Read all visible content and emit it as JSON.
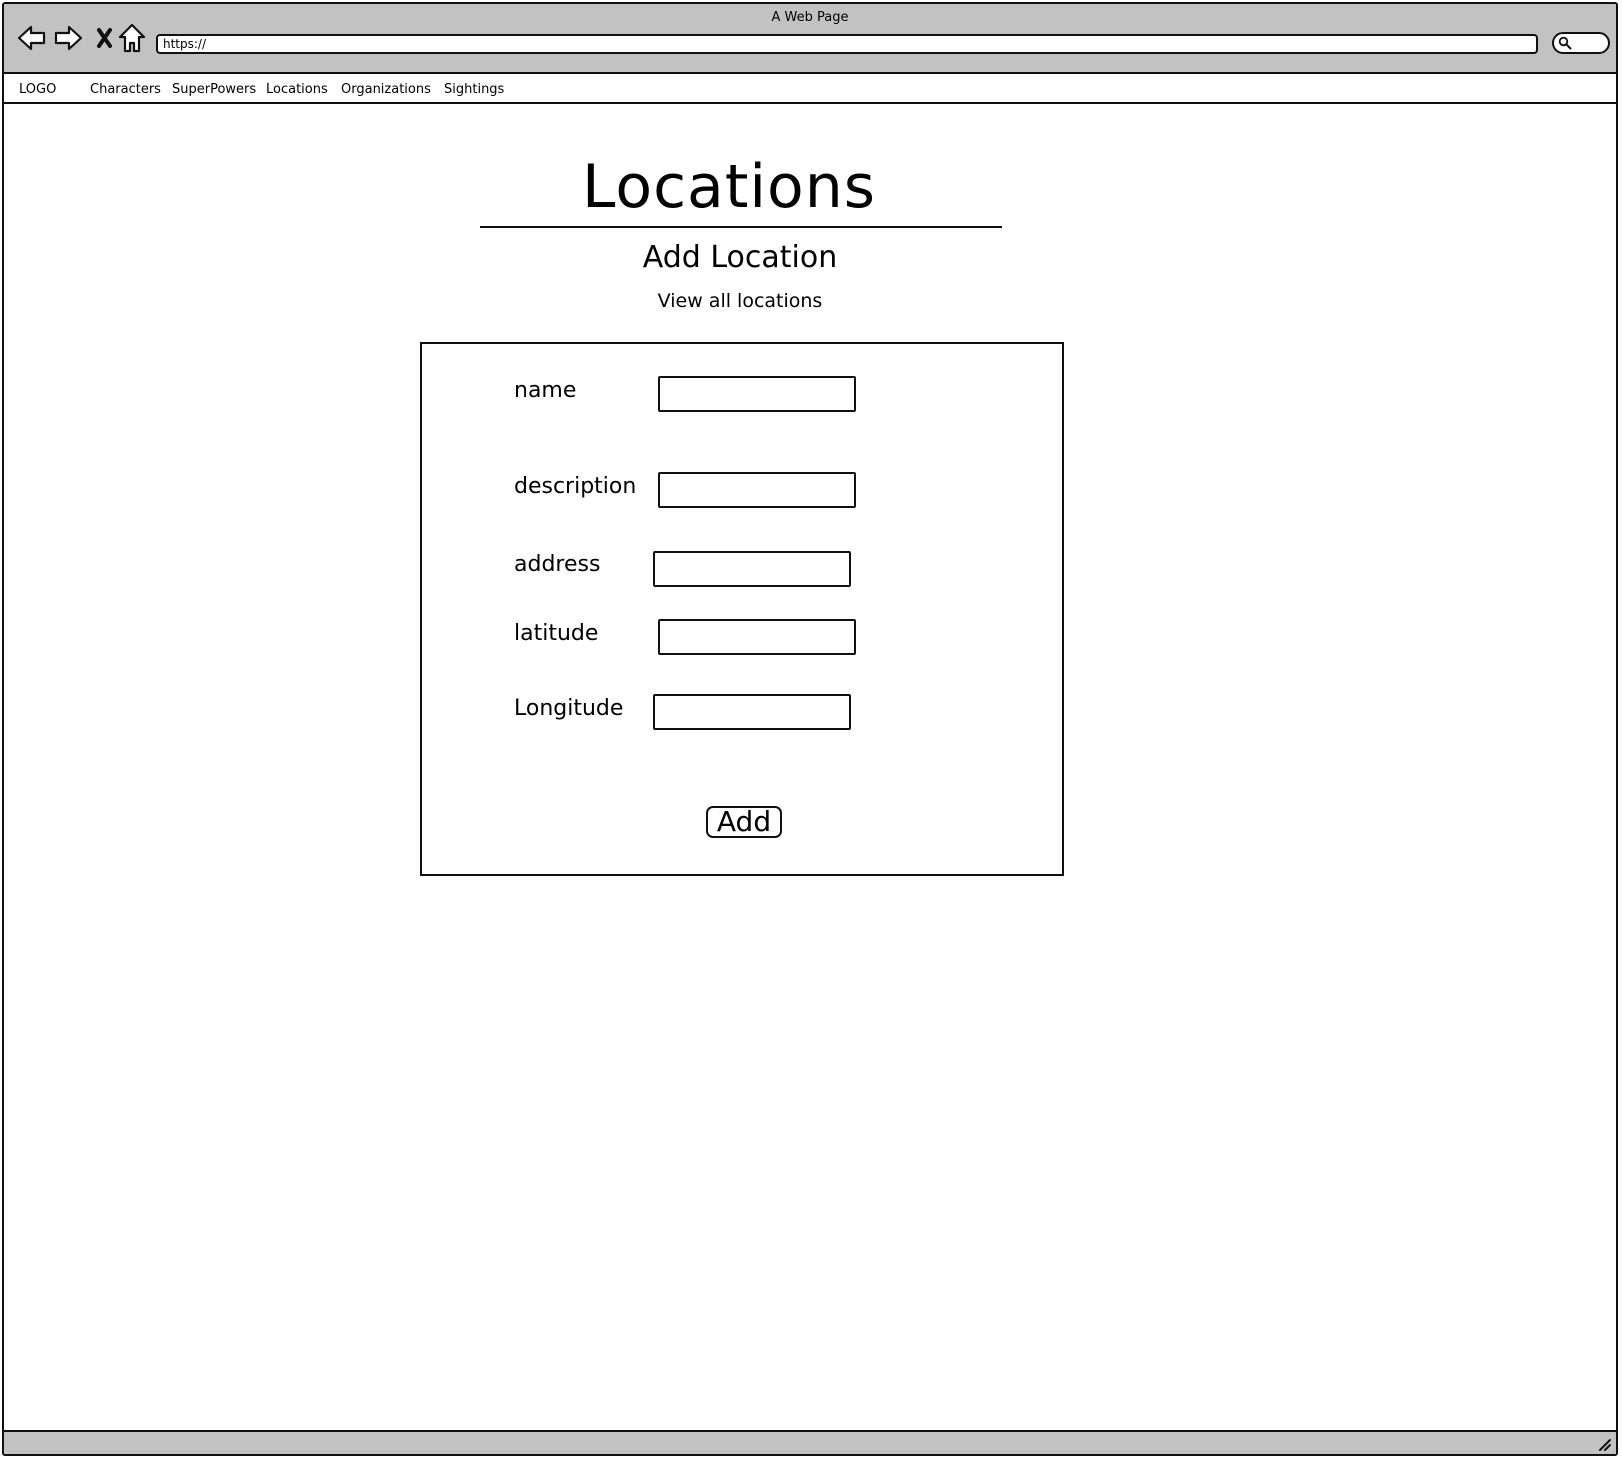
{
  "window": {
    "title": "A Web Page"
  },
  "toolbar": {
    "back_icon": "arrow-left-icon",
    "forward_icon": "arrow-right-icon",
    "stop_icon": "close-icon",
    "home_icon": "home-icon",
    "url": "https://",
    "search_icon": "search-icon"
  },
  "menu": {
    "logo": "LOGO",
    "items": [
      {
        "label": "Characters"
      },
      {
        "label": "SuperPowers"
      },
      {
        "label": "Locations"
      },
      {
        "label": "Organizations"
      },
      {
        "label": "Sightings"
      }
    ]
  },
  "main": {
    "title": "Locations",
    "subtitle": "Add Location",
    "view_all_link": "View all locations"
  },
  "form": {
    "fields": [
      {
        "label": "name",
        "value": ""
      },
      {
        "label": "description",
        "value": ""
      },
      {
        "label": "address",
        "value": ""
      },
      {
        "label": "latitude",
        "value": ""
      },
      {
        "label": "Longitude",
        "value": ""
      }
    ],
    "submit_label": "Add"
  },
  "colors": {
    "chrome": "#c2c2c2",
    "border": "#111111",
    "background": "#ffffff"
  }
}
